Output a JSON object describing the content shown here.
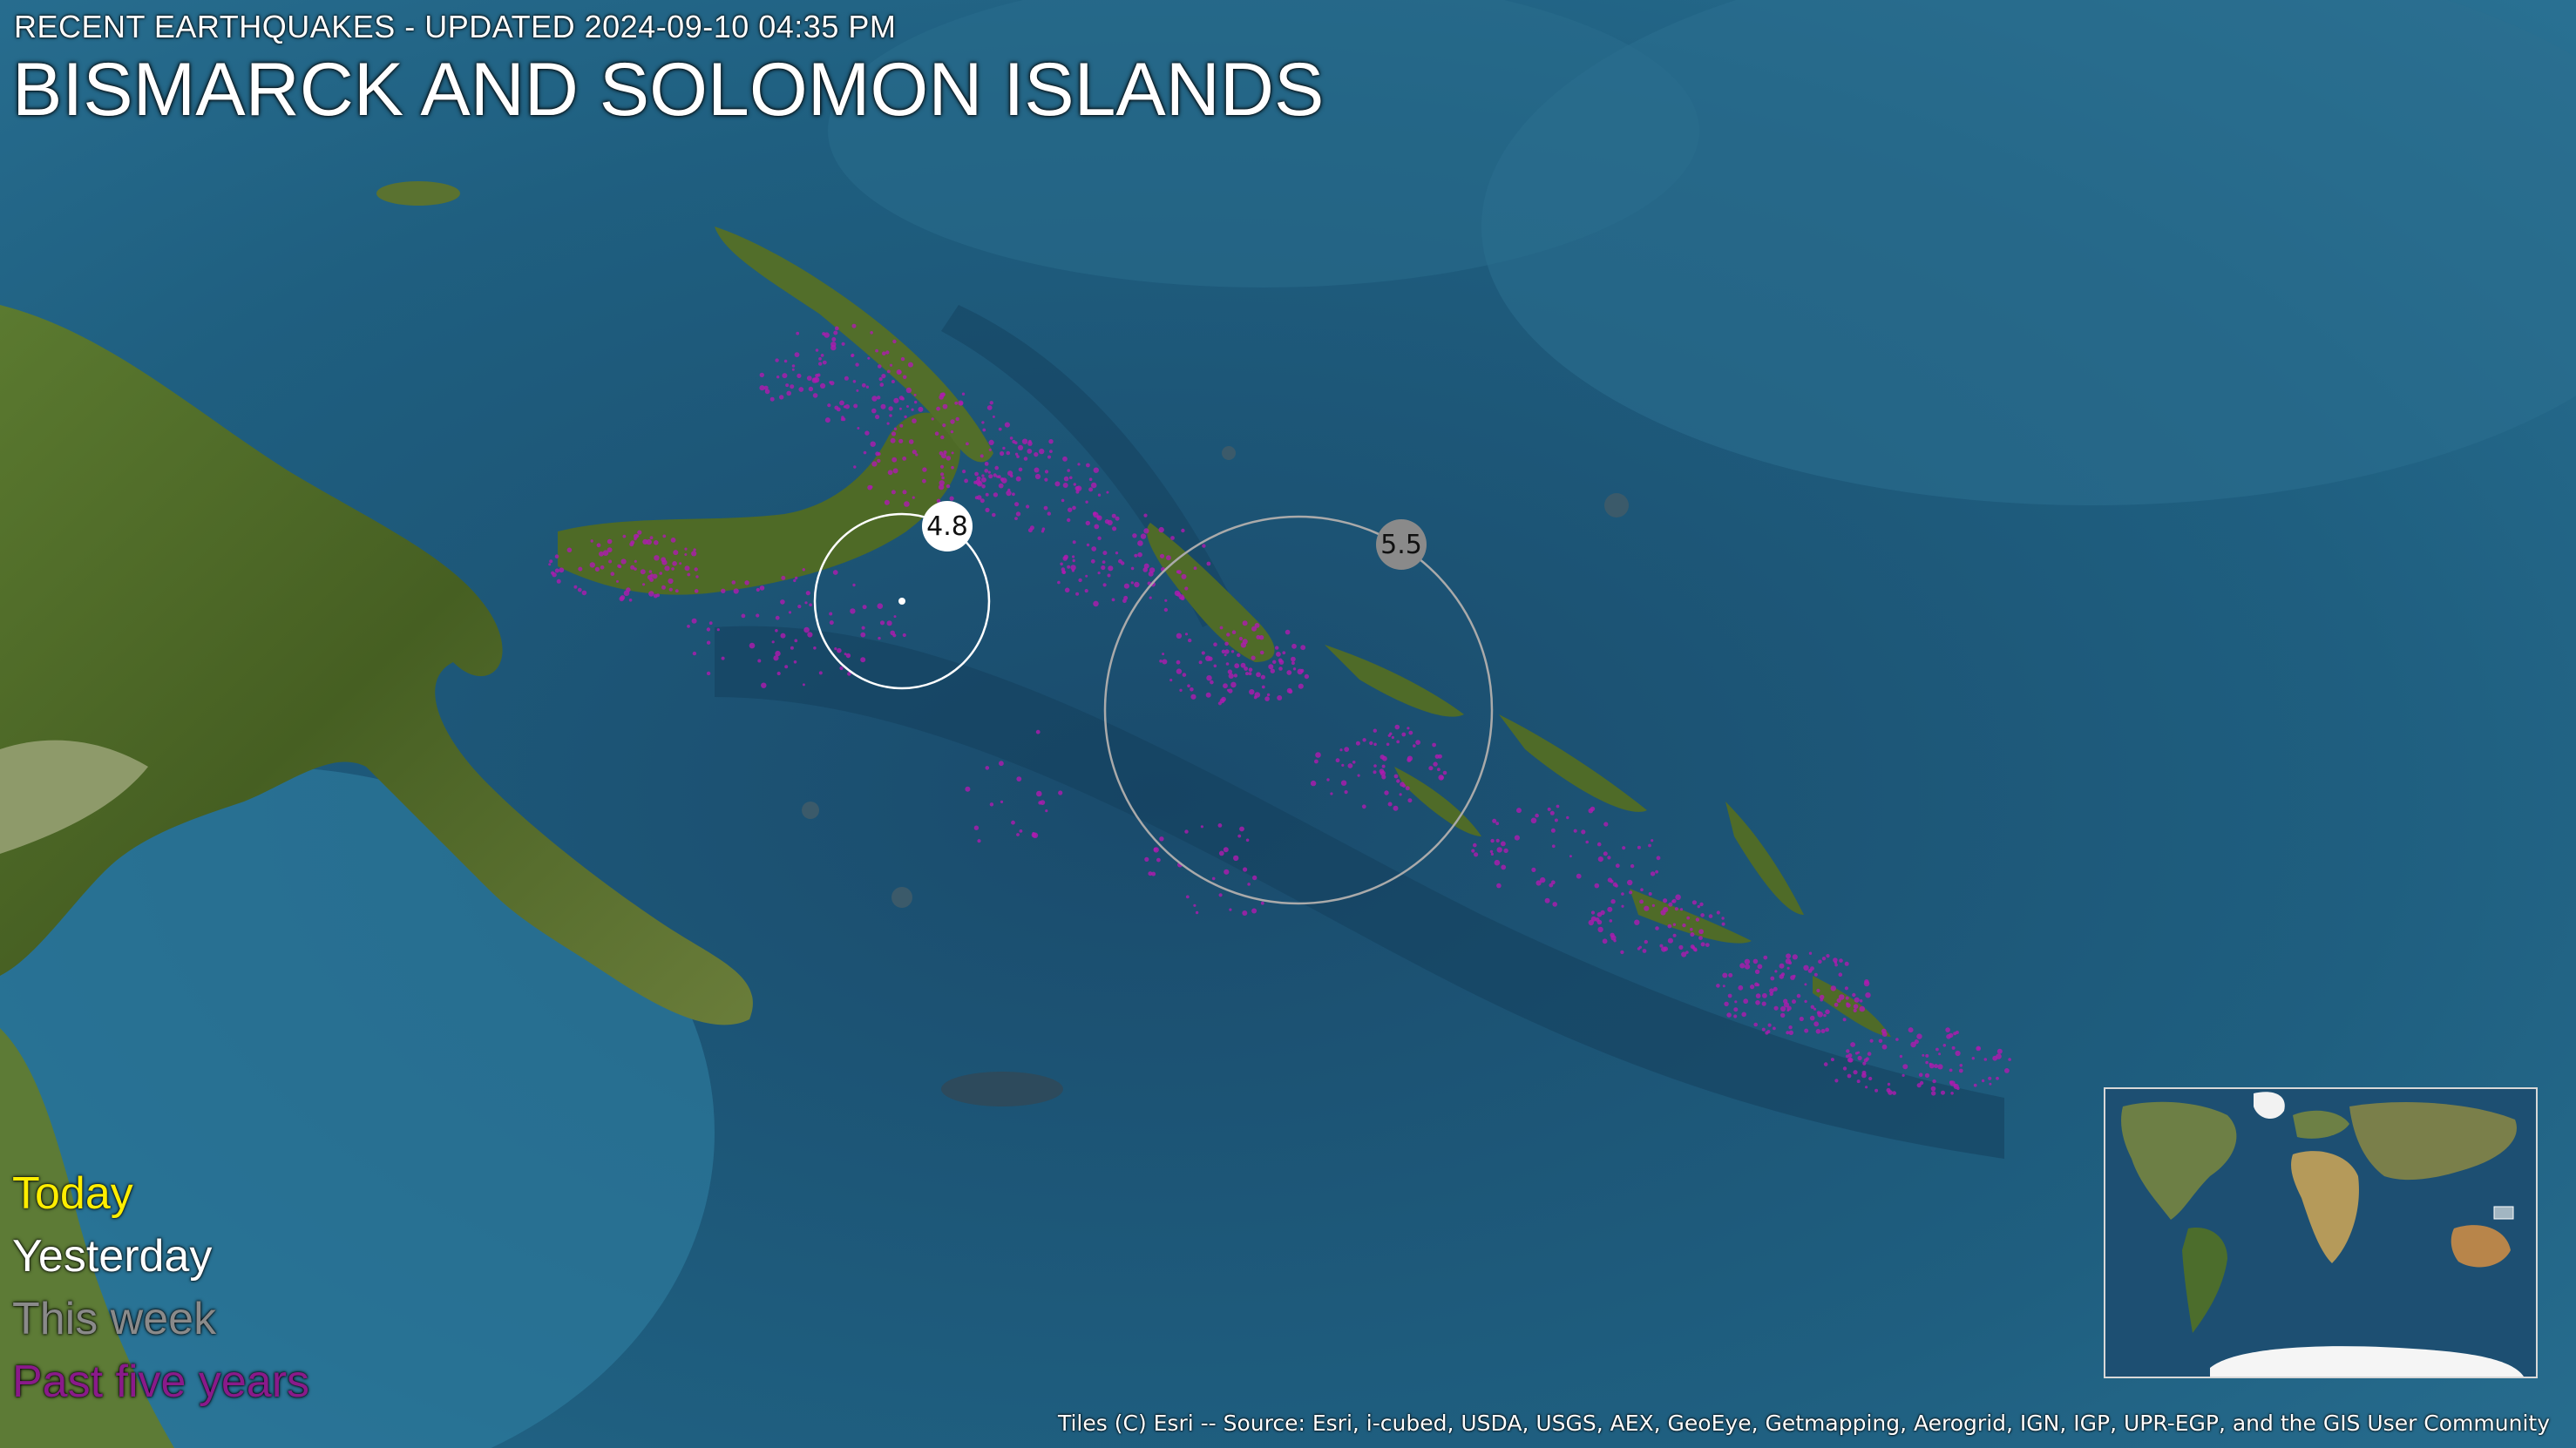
{
  "header": {
    "subtitle": "RECENT EARTHQUAKES - UPDATED 2024-09-10 04:35 PM",
    "title": "BISMARCK AND SOLOMON ISLANDS"
  },
  "legend": {
    "items": [
      {
        "label": "Today",
        "color": "#ffee00"
      },
      {
        "label": "Yesterday",
        "color": "#ffffff"
      },
      {
        "label": "This week",
        "color": "#8a8a8a"
      },
      {
        "label": "Past five years",
        "color": "#8a1a8a"
      }
    ]
  },
  "quakes": [
    {
      "magnitude": "4.8",
      "period": "Yesterday",
      "color": "#ffffff"
    },
    {
      "magnitude": "5.5",
      "period": "This week",
      "color": "#8a8a8a"
    }
  ],
  "attribution": "Tiles (C) Esri -- Source: Esri, i-cubed, USDA, USGS, AEX, GeoEye, Getmapping, Aerogrid, IGN, IGP, UPR-EGP, and the GIS User Community",
  "colors": {
    "ocean_deep": "#1b5070",
    "ocean_shelf": "#2f7fa0",
    "land": "#4f6d2a",
    "past_quake": "#b01ab0"
  }
}
